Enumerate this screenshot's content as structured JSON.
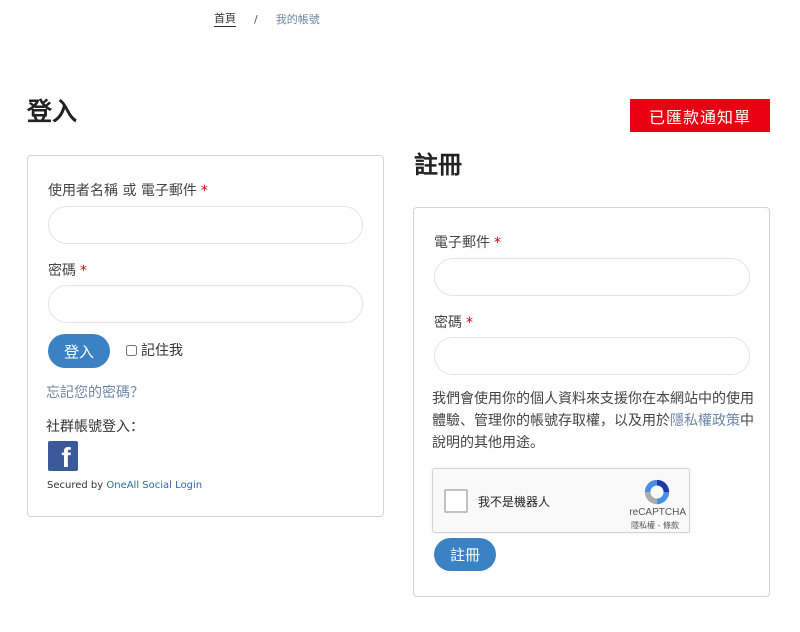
{
  "breadcrumb": {
    "home": "首頁",
    "separator": "/",
    "current": "我的帳號"
  },
  "notice_button": "已匯款通知單",
  "login": {
    "title": "登入",
    "username_label": "使用者名稱 或 電子郵件",
    "password_label": "密碼",
    "required_mark": "*",
    "submit_label": "登入",
    "remember_label": "記住我",
    "forgot_link": "忘記您的密碼？",
    "social_label": "社群帳號登入：",
    "facebook_glyph": "f",
    "secured_prefix": "Secured by",
    "secured_brand": "OneAll Social Login"
  },
  "register": {
    "title": "註冊",
    "email_label": "電子郵件",
    "password_label": "密碼",
    "required_mark": "*",
    "privacy_text_before": "我們會使用你的個人資料來支援你在本網站中的使用體驗、管理你的帳號存取權，以及用於",
    "privacy_link": "隱私權政策",
    "privacy_text_after": "中說明的其他用途。",
    "recaptcha_label": "我不是機器人",
    "recaptcha_brand": "reCAPTCHA",
    "recaptcha_terms": "隱私權 - 條款",
    "submit_label": "註冊"
  },
  "colors": {
    "notice_red": "#e80012",
    "primary_blue": "#3b82c4",
    "link": "#6d87a8",
    "facebook": "#3b5998"
  }
}
